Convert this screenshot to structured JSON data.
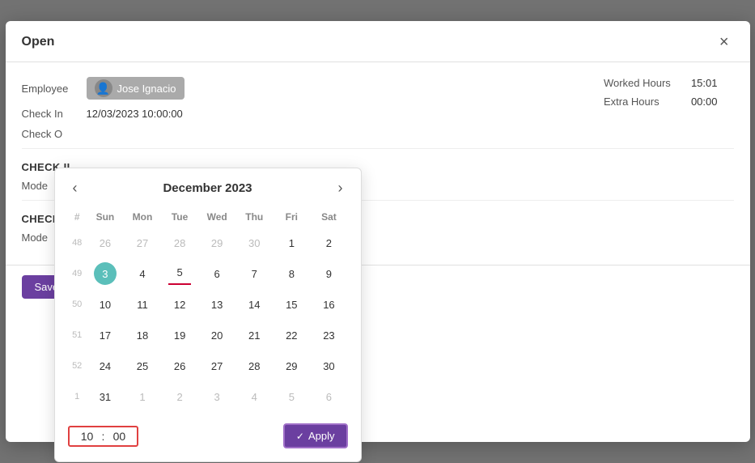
{
  "modal": {
    "title": "Open",
    "close_label": "×"
  },
  "form": {
    "employee_label": "Employee",
    "employee_name": "Jose Ignacio",
    "check_in_label": "Check In",
    "check_in_value": "12/03/2023 10:00:00",
    "check_out_label": "Check O",
    "worked_hours_label": "Worked Hours",
    "worked_hours_value": "15:01",
    "extra_hours_label": "Extra Hours",
    "extra_hours_value": "00:00",
    "check_in_section": "CHECK II",
    "mode_label": "Mode",
    "check_out_section": "CHECK C",
    "mode_label2": "Mode"
  },
  "buttons": {
    "save_label": "Save &",
    "apply_label": "Apply"
  },
  "calendar": {
    "month_title": "December 2023",
    "prev_label": "‹",
    "next_label": "›",
    "headers": [
      "#",
      "Sun",
      "Mon",
      "Tue",
      "Wed",
      "Thu",
      "Fri",
      "Sat"
    ],
    "weeks": [
      {
        "week_num": "48",
        "days": [
          {
            "day": "26",
            "outside": true
          },
          {
            "day": "27",
            "outside": true
          },
          {
            "day": "28",
            "outside": true
          },
          {
            "day": "29",
            "outside": true
          },
          {
            "day": "30",
            "outside": true
          },
          {
            "day": "1"
          },
          {
            "day": "2"
          }
        ]
      },
      {
        "week_num": "49",
        "days": [
          {
            "day": "3",
            "selected": true
          },
          {
            "day": "4"
          },
          {
            "day": "5",
            "underline": true
          },
          {
            "day": "6"
          },
          {
            "day": "7"
          },
          {
            "day": "8"
          },
          {
            "day": "9"
          }
        ]
      },
      {
        "week_num": "50",
        "days": [
          {
            "day": "10"
          },
          {
            "day": "11"
          },
          {
            "day": "12"
          },
          {
            "day": "13"
          },
          {
            "day": "14"
          },
          {
            "day": "15"
          },
          {
            "day": "16"
          }
        ]
      },
      {
        "week_num": "51",
        "days": [
          {
            "day": "17"
          },
          {
            "day": "18"
          },
          {
            "day": "19"
          },
          {
            "day": "20"
          },
          {
            "day": "21"
          },
          {
            "day": "22"
          },
          {
            "day": "23"
          }
        ]
      },
      {
        "week_num": "52",
        "days": [
          {
            "day": "24"
          },
          {
            "day": "25"
          },
          {
            "day": "26"
          },
          {
            "day": "27"
          },
          {
            "day": "28"
          },
          {
            "day": "29"
          },
          {
            "day": "30"
          }
        ]
      },
      {
        "week_num": "1",
        "days": [
          {
            "day": "31"
          },
          {
            "day": "1",
            "outside": true
          },
          {
            "day": "2",
            "outside": true
          },
          {
            "day": "3",
            "outside": true
          },
          {
            "day": "4",
            "outside": true
          },
          {
            "day": "5",
            "outside": true
          },
          {
            "day": "6",
            "outside": true
          }
        ]
      }
    ],
    "time_hour": "10",
    "time_minute": "00"
  }
}
